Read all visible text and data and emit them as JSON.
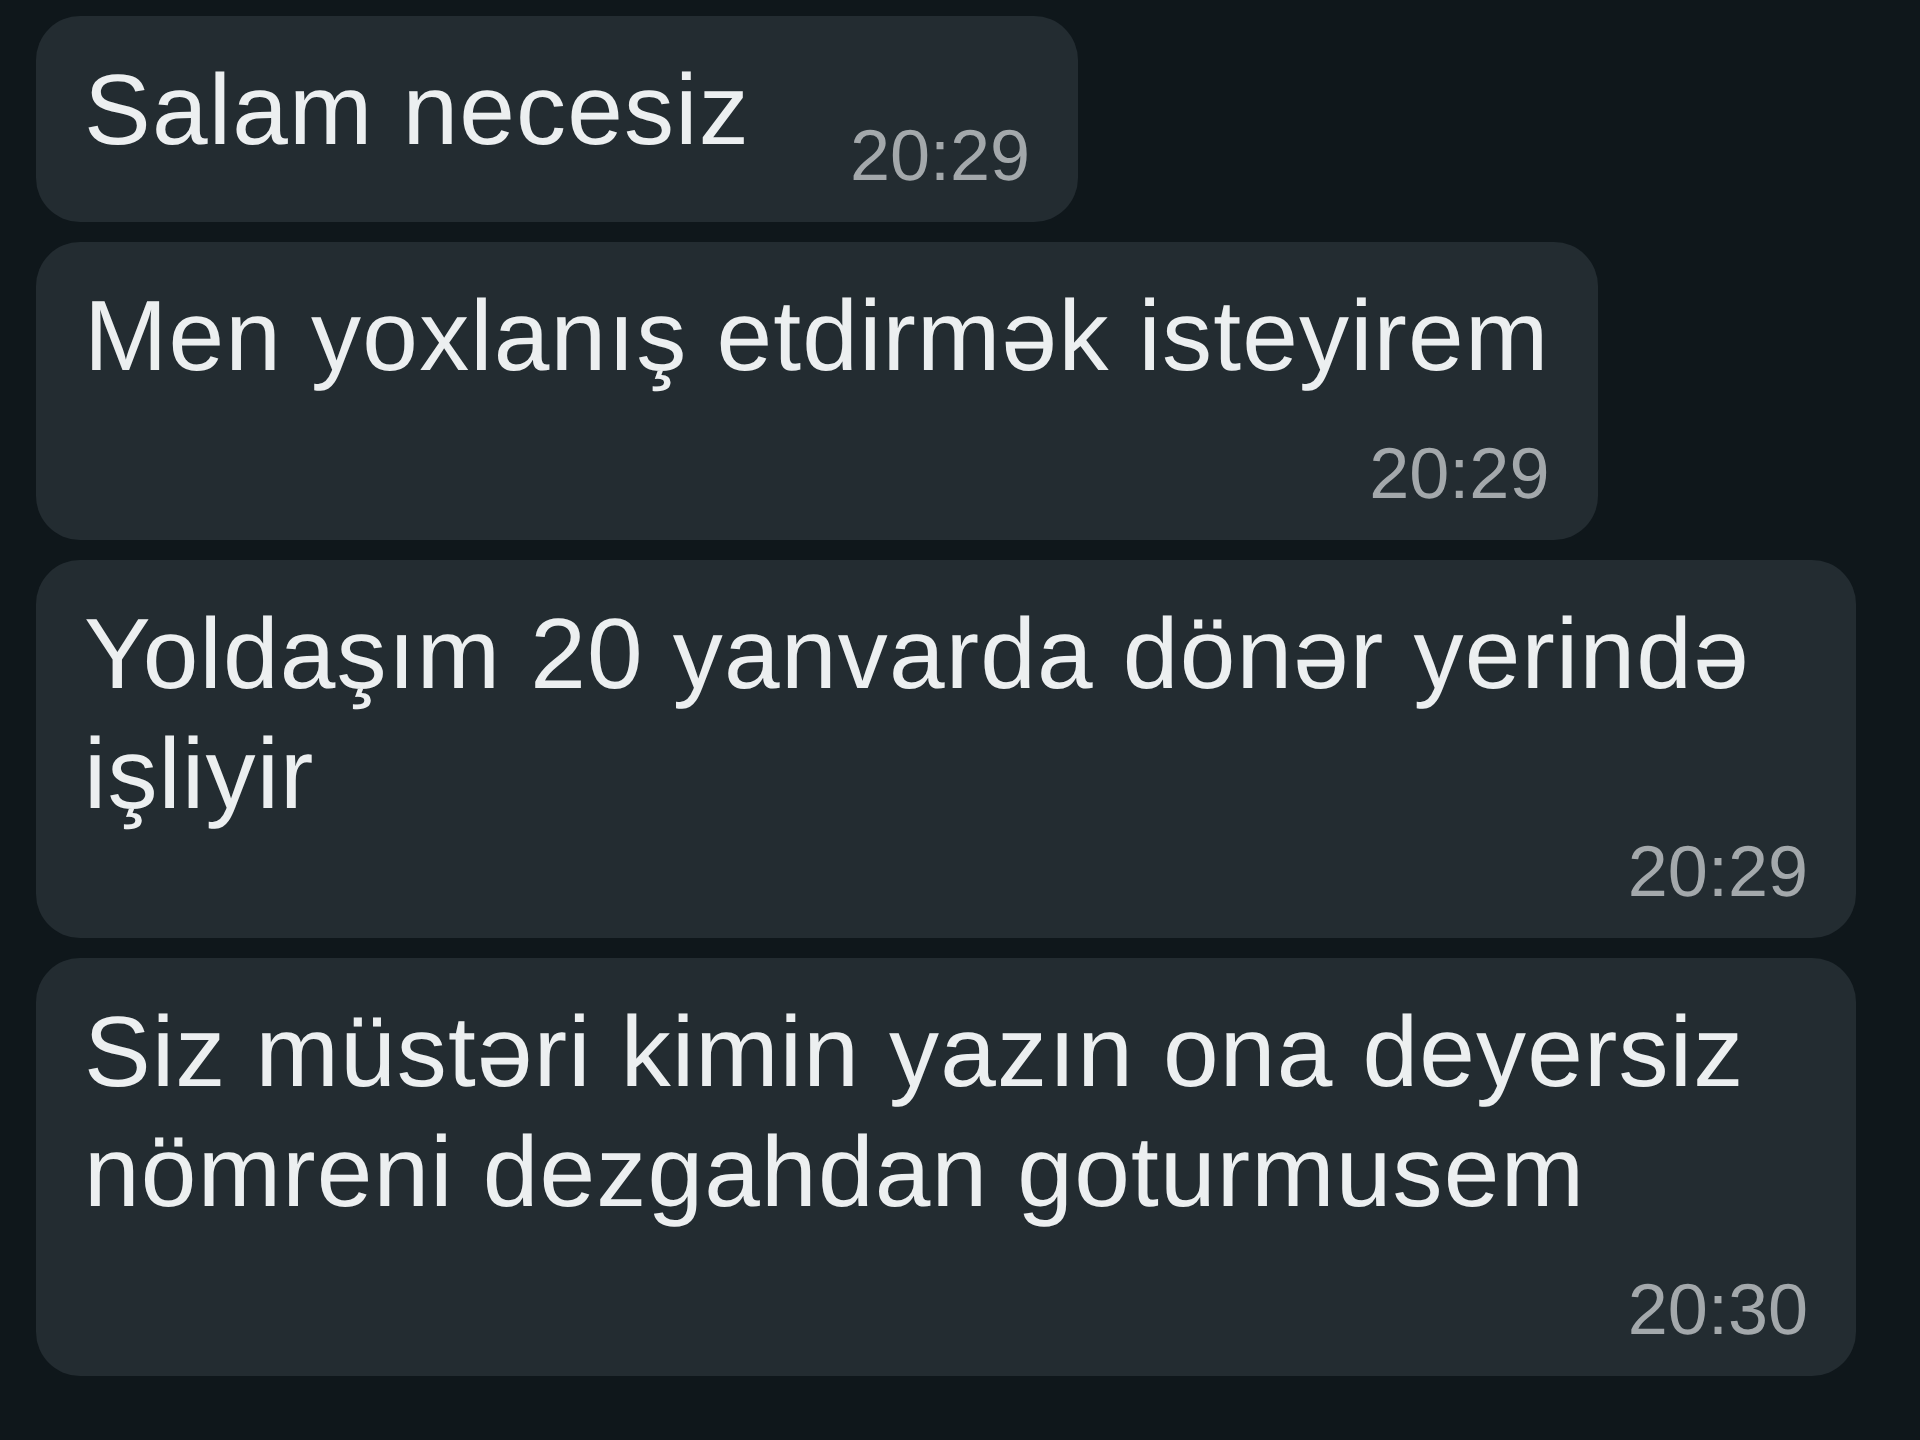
{
  "messages": [
    {
      "text": "Salam necesiz",
      "time": "20:29"
    },
    {
      "text": "Men yoxlanış etdirmək isteyirem",
      "time": "20:29"
    },
    {
      "text": "Yoldaşım 20 yanvarda dönər yerində işliyir",
      "time": "20:29"
    },
    {
      "text": "Siz müstəri kimin yazın ona deyersiz nömreni dezgahdan goturmusem",
      "time": "20:30"
    }
  ]
}
